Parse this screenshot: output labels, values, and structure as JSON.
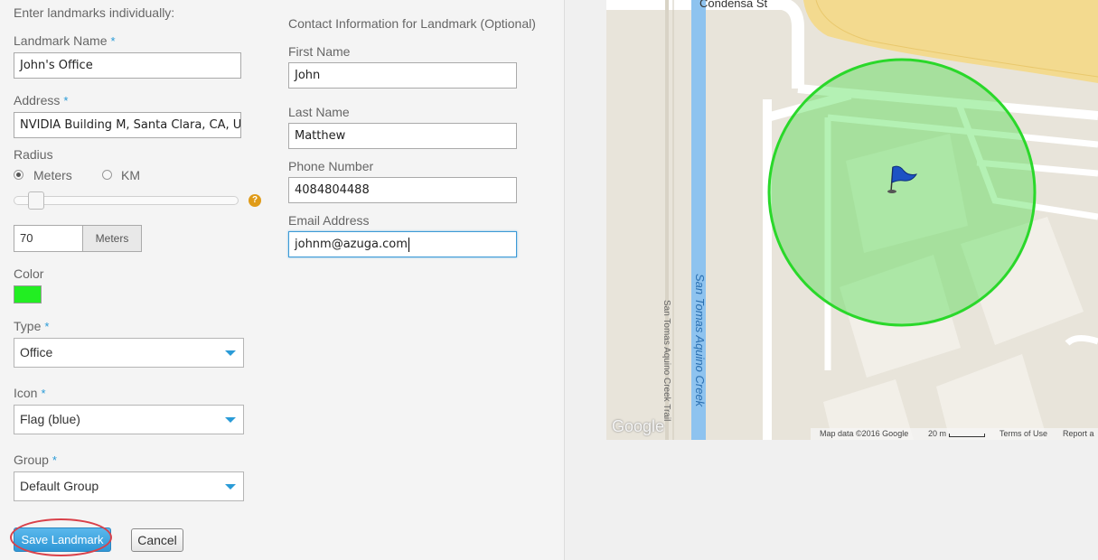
{
  "section_left_title": "Enter landmarks individually:",
  "section_right_title": "Contact Information for Landmark (Optional)",
  "landmark_name": {
    "label": "Landmark Name",
    "value": "John's Office"
  },
  "address": {
    "label": "Address",
    "value": "NVIDIA Building M, Santa Clara, CA, Un"
  },
  "radius": {
    "label": "Radius",
    "option_meters": "Meters",
    "option_km": "KM",
    "selected": "Meters",
    "slider_fraction": 0.07,
    "help": "?",
    "value": "70",
    "unit": "Meters"
  },
  "color": {
    "label": "Color",
    "value": "#22ee22"
  },
  "type": {
    "label": "Type",
    "value": "Office"
  },
  "icon": {
    "label": "Icon",
    "value": "Flag (blue)"
  },
  "group": {
    "label": "Group",
    "value": "Default Group"
  },
  "buttons": {
    "save": "Save Landmark",
    "cancel": "Cancel"
  },
  "contact": {
    "first_name": {
      "label": "First Name",
      "value": "John"
    },
    "last_name": {
      "label": "Last Name",
      "value": "Matthew"
    },
    "phone": {
      "label": "Phone Number",
      "value": "4084804488"
    },
    "email": {
      "label": "Email Address",
      "value": "johnm@azuga.com"
    }
  },
  "map": {
    "street_top": "Condensa St",
    "creek_label": "San Tomas Aquino Creek",
    "trail_label": "San Tomas Aquino Creek Trail",
    "google_logo": "Google",
    "map_data": "Map data ©2016 Google",
    "scale": "20 m",
    "terms": "Terms of Use",
    "report": "Report a",
    "marker_icon": "flag-blue-icon",
    "geofence_color": "#3ad93a"
  },
  "required_mark": "*"
}
